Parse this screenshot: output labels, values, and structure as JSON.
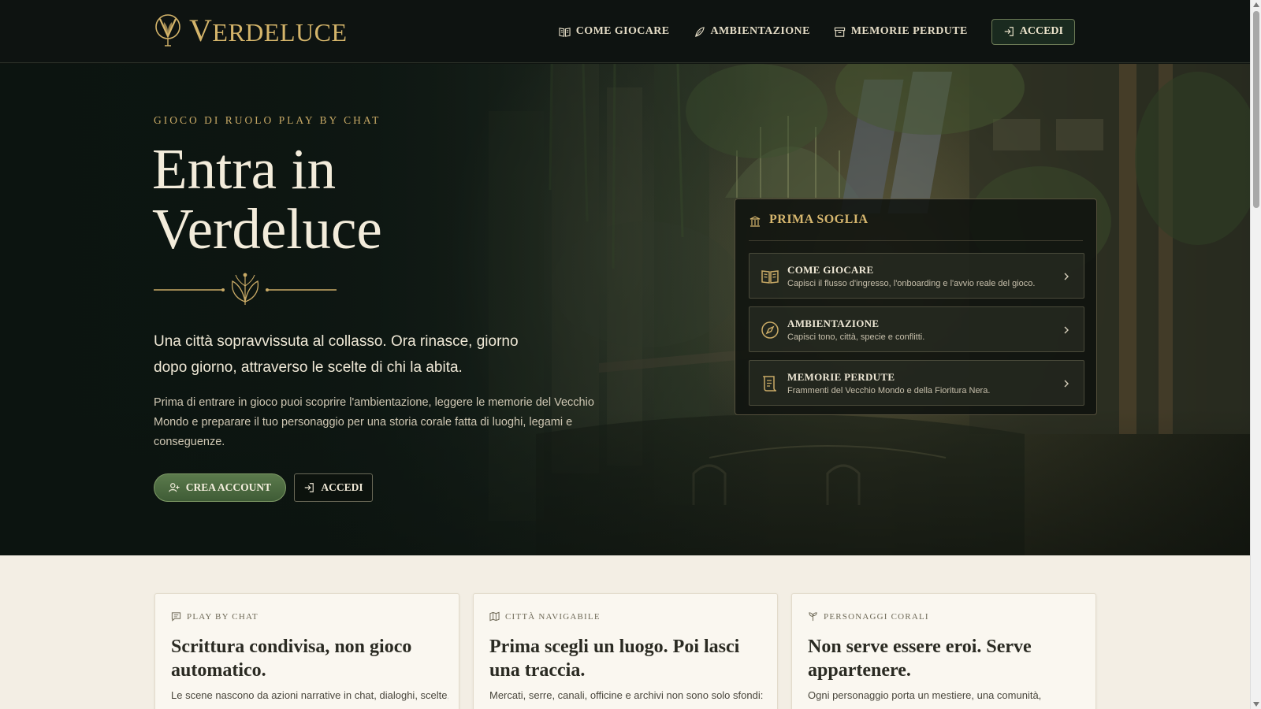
{
  "brand": {
    "initial": "V",
    "rest": "ERDELUCE"
  },
  "nav": {
    "items": [
      {
        "label": "COME GIOCARE",
        "icon": "book-open-icon"
      },
      {
        "label": "AMBIENTAZIONE",
        "icon": "feather-icon"
      },
      {
        "label": "MEMORIE PERDUTE",
        "icon": "archive-icon"
      }
    ],
    "login_label": "ACCEDI"
  },
  "hero": {
    "eyebrow": "GIOCO DI RUOLO PLAY BY CHAT",
    "title_line1": "Entra in",
    "title_line2": "Verdeluce",
    "lead": "Una città sopravvissuta al collasso. Ora rinasce, giorno dopo giorno, attraverso le scelte di chi la abita.",
    "body": "Prima di entrare in gioco puoi scoprire l'ambientazione, leggere le memorie del Vecchio Mondo e preparare il tuo personaggio per una storia corale fatta di luoghi, legami e conseguenze.",
    "create_label": "CREA ACCOUNT",
    "login_label": "ACCEDI"
  },
  "panel": {
    "title": "PRIMA SOGLIA",
    "items": [
      {
        "title": "COME GIOCARE",
        "desc": "Capisci il flusso d'ingresso, l'onboarding e l'avvio reale del gioco.",
        "icon": "book-open-icon"
      },
      {
        "title": "AMBIENTAZIONE",
        "desc": "Capisci tono, città, specie e conflitti.",
        "icon": "compass-icon"
      },
      {
        "title": "MEMORIE PERDUTE",
        "desc": "Frammenti del Vecchio Mondo e della Fioritura Nera.",
        "icon": "scroll-icon"
      }
    ]
  },
  "cards": [
    {
      "tag": "PLAY BY CHAT",
      "icon": "chat-icon",
      "title": "Scrittura condivisa, non gioco automatico.",
      "text": "Le scene nascono da azioni narrative in chat, dialoghi, scelte,"
    },
    {
      "tag": "CITTÀ NAVIGABILE",
      "icon": "map-icon",
      "title": "Prima scegli un luogo. Poi lasci una traccia.",
      "text": "Mercati, serre, canali, officine e archivi non sono solo sfondi:"
    },
    {
      "tag": "PERSONAGGI CORALI",
      "icon": "sprout-icon",
      "title": "Non serve essere eroi. Serve appartenere.",
      "text": "Ogni personaggio porta un mestiere, una comunità,"
    }
  ],
  "colors": {
    "gold": "#d4b46a",
    "accent_green": "#4a6b40",
    "dark": "#0e1311",
    "cream": "#f3eee4"
  }
}
